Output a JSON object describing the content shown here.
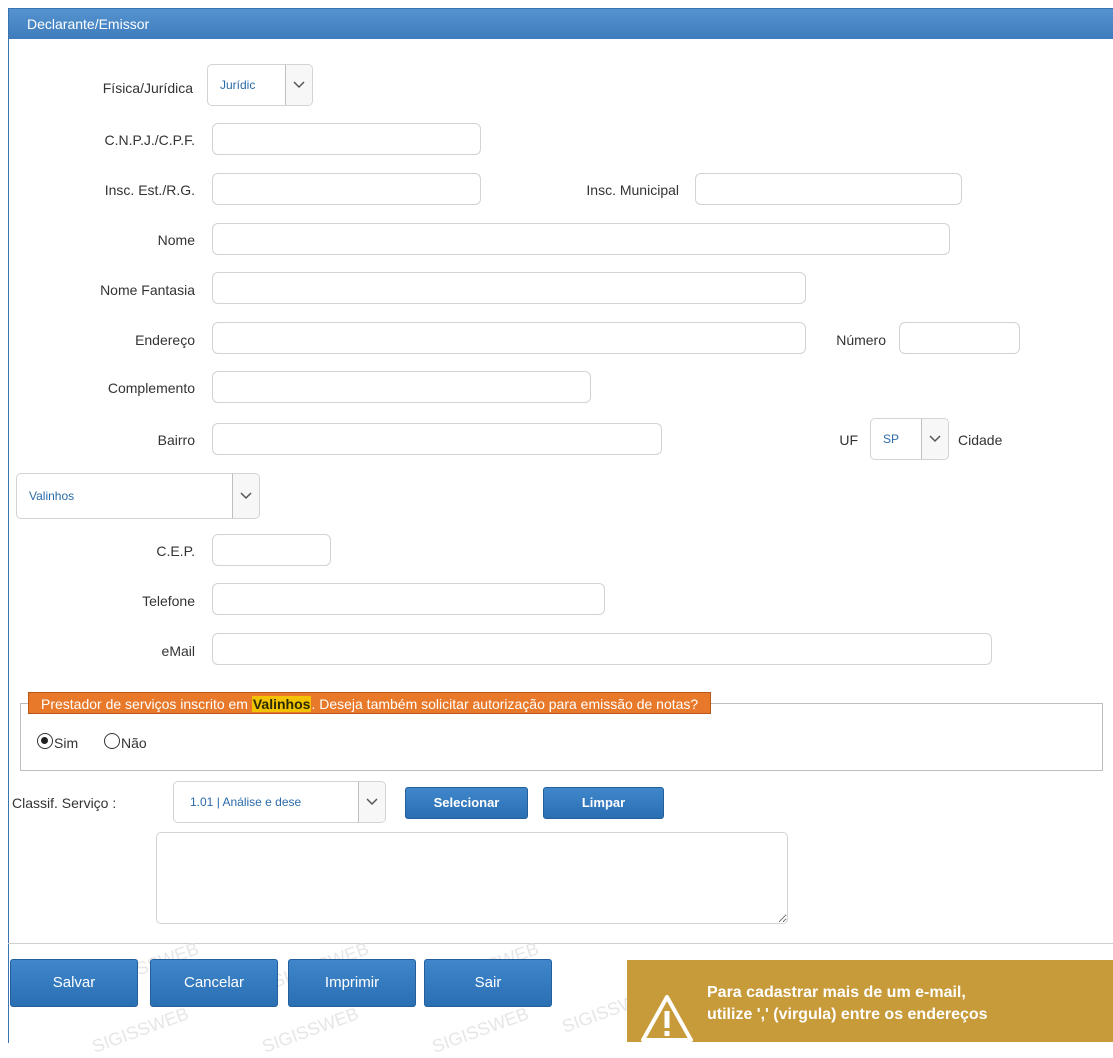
{
  "panel": {
    "title": "Declarante/Emissor"
  },
  "form": {
    "tipo": {
      "label": "Física/Jurídica",
      "value": "Jurídic"
    },
    "cnpj": {
      "label": "C.N.P.J./C.P.F.",
      "value": ""
    },
    "insc_est": {
      "label": "Insc. Est./R.G.",
      "value": ""
    },
    "insc_mun": {
      "label": "Insc. Municipal",
      "value": ""
    },
    "nome": {
      "label": "Nome",
      "value": ""
    },
    "fantasia": {
      "label": "Nome Fantasia",
      "value": ""
    },
    "endereco": {
      "label": "Endereço",
      "value": ""
    },
    "numero": {
      "label": "Número",
      "value": ""
    },
    "complemento": {
      "label": "Complemento",
      "value": ""
    },
    "bairro": {
      "label": "Bairro",
      "value": ""
    },
    "uf": {
      "label": "UF",
      "value": "SP"
    },
    "cidade": {
      "label": "Cidade",
      "value": "Valinhos"
    },
    "cep": {
      "label": "C.E.P.",
      "value": ""
    },
    "telefone": {
      "label": "Telefone",
      "value": ""
    },
    "email": {
      "label": "eMail",
      "value": ""
    }
  },
  "prestador": {
    "text_before": "Prestador de serviços inscrito em ",
    "city": "Valinhos",
    "text_after": ". Deseja também solicitar autorização para emissão de notas?",
    "sim": "Sim",
    "nao": "Não",
    "selected": "Sim"
  },
  "classif": {
    "label": "Classif. Serviço :",
    "value": "1.01 | Análise e dese",
    "select_button": "Selecionar",
    "clear_button": "Limpar",
    "textarea": ""
  },
  "actions": {
    "save": "Salvar",
    "cancel": "Cancelar",
    "print": "Imprimir",
    "exit": "Sair"
  },
  "toast": {
    "line1": "Para cadastrar mais de um e-mail,",
    "line2": "utilize ',' (virgula) entre os endereços",
    "color": "#c79a3a"
  },
  "colors": {
    "header": "#3e7cbd",
    "button": "#2b6fb3",
    "legend": "#e8792a"
  }
}
